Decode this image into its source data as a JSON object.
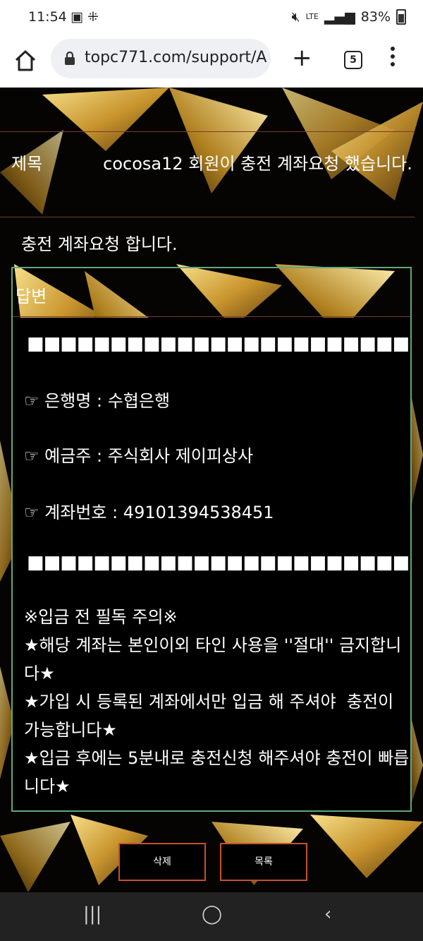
{
  "status_bar": {
    "time": "11:54",
    "lte": "LTE",
    "battery": "83%"
  },
  "browser": {
    "url": "topc771.com/support/A",
    "tab_count": "5"
  },
  "post": {
    "subject_label": "제목",
    "subject_text": "cocosa12 회원이 충전 계좌요청 했습니다.",
    "body": "충전 계좌요청 합니다."
  },
  "answer": {
    "title": "답변",
    "squares": "■■■■■■■■■■■■■■■■■■■■■■■■■■",
    "bank_line": "☞ 은행명 : 수협은행",
    "holder_line": "☞ 예금주 : 주식회사 제이피상사",
    "account_line": "☞ 계좌번호 :  49101394538451",
    "notice_lines": [
      "※입금 전 필독 주의※",
      "★해당 계좌는 본인이외 타인 사용을 ''절대'' 금지합니다★",
      "★가입 시 등록된 계좌에서만 입금 해 주셔야  충전이 가능합니다★",
      "★입금 후에는 5분내로 충전신청 해주셔야 충전이 빠릅니다★"
    ]
  },
  "buttons": {
    "delete": "삭제",
    "list": "목록"
  },
  "colors": {
    "accent_border": "#c9502a",
    "answer_border": "#5fa87a"
  }
}
